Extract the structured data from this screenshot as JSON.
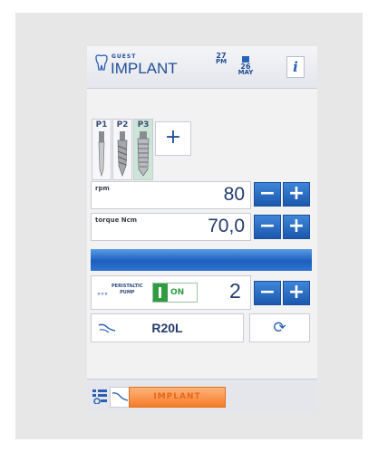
{
  "header": {
    "user": "GUEST",
    "mode": "IMPLANT",
    "date1": {
      "day": "27",
      "sub": "PM"
    },
    "date2": {
      "day": "26",
      "sub": "MAY"
    },
    "info_icon": "info-icon"
  },
  "programs": {
    "items": [
      {
        "label": "P1",
        "active": false
      },
      {
        "label": "P2",
        "active": false
      },
      {
        "label": "P3",
        "active": true
      }
    ],
    "add_label": "+"
  },
  "speed": {
    "label": "rpm",
    "value": "80",
    "minus": "−",
    "plus": "+"
  },
  "torque": {
    "label": "torque Ncm",
    "value": "70,0",
    "minus": "−",
    "plus": "+"
  },
  "pump": {
    "label_line1": "PERISTALTIC",
    "label_line2": "PUMP",
    "toggle_state": "ON",
    "value": "2",
    "minus": "−",
    "plus": "+"
  },
  "program_name": "R20L",
  "footer": {
    "mode_button": "IMPLANT"
  }
}
